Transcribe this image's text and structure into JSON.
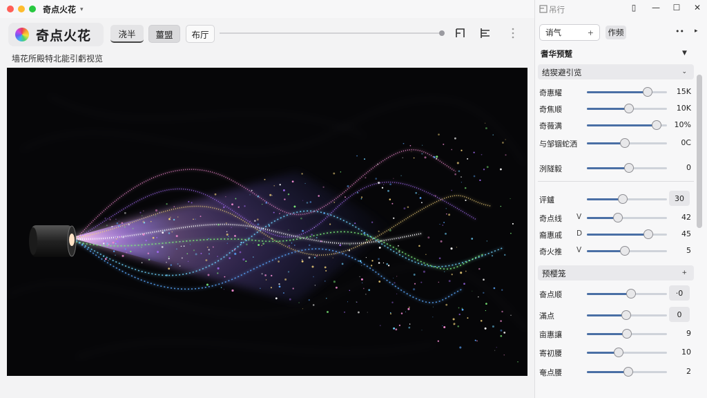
{
  "window": {
    "title": "奇点火花",
    "app_name": "奇点火花",
    "tabs": [
      {
        "label": "浇半"
      },
      {
        "label": "薑盟"
      },
      {
        "label": "布厅"
      }
    ],
    "preview_caption": "墙花所殿特北能引虧视览"
  },
  "panel": {
    "title": "吊行",
    "controls": {
      "doc": "▯",
      "min": "—",
      "max": "☐",
      "close": "✕"
    },
    "preset": {
      "value": "诮气",
      "plus": "+",
      "action": "作频",
      "more": "••",
      "arrow": "▸"
    },
    "section_main": {
      "title": "耆华预蹵",
      "chevron": "▼"
    },
    "subsection_1": {
      "title": "结猰避引览",
      "chevron": "⌄"
    },
    "group_1": [
      {
        "label": "奇惠耀",
        "axis": "",
        "level": 0.76,
        "value": "15K"
      },
      {
        "label": "奇焦顺",
        "axis": "",
        "level": 0.53,
        "value": "10K"
      },
      {
        "label": "奇薇满",
        "axis": "",
        "level": 0.87,
        "value": "10%"
      },
      {
        "label": "与邹锢蛇洒",
        "axis": "",
        "level": 0.47,
        "value": "0C"
      },
      {
        "label": "洌隧毅",
        "axis": "",
        "level": 0.53,
        "value": "0"
      }
    ],
    "group_2": [
      {
        "label": "评鑪",
        "axis": "",
        "level": 0.45,
        "value": "30",
        "boxed": true
      },
      {
        "label": "奇点线",
        "axis": "V",
        "level": 0.39,
        "value": "42"
      },
      {
        "label": "裔惠戚",
        "axis": "D",
        "level": 0.77,
        "value": "45"
      },
      {
        "label": "奇火推",
        "axis": "V",
        "level": 0.47,
        "value": "5"
      }
    ],
    "subsection_2": {
      "title": "预樱笼",
      "chevron": "+"
    },
    "group_3": [
      {
        "label": "奋点顺",
        "axis": "",
        "level": 0.55,
        "value": "·0",
        "boxed": true
      },
      {
        "label": "滿点",
        "axis": "",
        "level": 0.49,
        "value": "0",
        "boxed": true
      },
      {
        "label": "亩惠讓",
        "axis": "",
        "level": 0.5,
        "value": "9"
      },
      {
        "label": "寄初腰",
        "axis": "",
        "level": 0.4,
        "value": "10"
      },
      {
        "label": "奄点腰",
        "axis": "",
        "level": 0.52,
        "value": "2"
      }
    ]
  },
  "colors": {
    "accent": "#4a6fa5",
    "canvas_bg": "#060608",
    "stream": [
      "#a36bf2",
      "#6fd4ff",
      "#f2d27a",
      "#7ef07a",
      "#f08ad0",
      "#5aa8ff",
      "#ffffff"
    ]
  },
  "icons": {
    "title_chevron": "chevron-down-icon",
    "frame": "frame-icon",
    "align": "align-icon",
    "more": "more-vertical-icon",
    "panel": "panel-icon"
  }
}
